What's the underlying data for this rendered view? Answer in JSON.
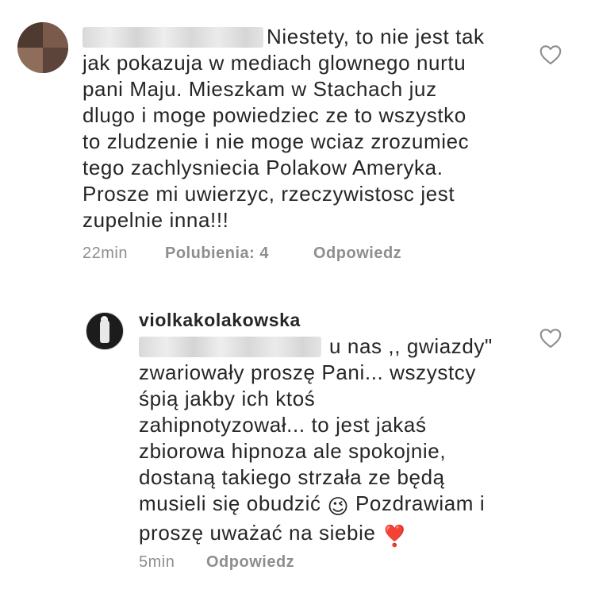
{
  "comments": [
    {
      "line_top": "Niestety, to nie jest tak",
      "lines": [
        "jak pokazuja w mediach glownego nurtu",
        "pani Maju. Mieszkam w Stachach juz",
        "dlugo i moge powiedziec ze to wszystko",
        "to zludzenie i nie moge wciaz zrozumiec",
        "tego zachlysniecia Polakow Ameryka.",
        "Prosze mi uwierzyc, rzeczywistosc jest",
        "zupelnie inna!!!"
      ],
      "time": "22min",
      "likes": "Polubienia: 4",
      "reply": "Odpowiedz",
      "like_icon": "heart-outline-icon"
    },
    {
      "username": "violkakolakowska",
      "line_top": "u nas ,, gwiazdy\"",
      "lines": [
        "zwariowały proszę Pani... wszystcy",
        "śpią jakby ich ktoś",
        "zahipnotyzował... to jest jakaś",
        "zbiorowa hipnoza ale spokojnie,",
        "dostaną takiego strzała ze będą"
      ],
      "line_emoji_before": "musieli się obudzić",
      "line_emoji_after": "Pozdrawiam i",
      "last_line": "proszę uważać na siebie",
      "emoji_wink": "😉",
      "emoji_heart": "❣️",
      "time": "5min",
      "reply": "Odpowiedz",
      "like_icon": "heart-outline-icon"
    }
  ]
}
